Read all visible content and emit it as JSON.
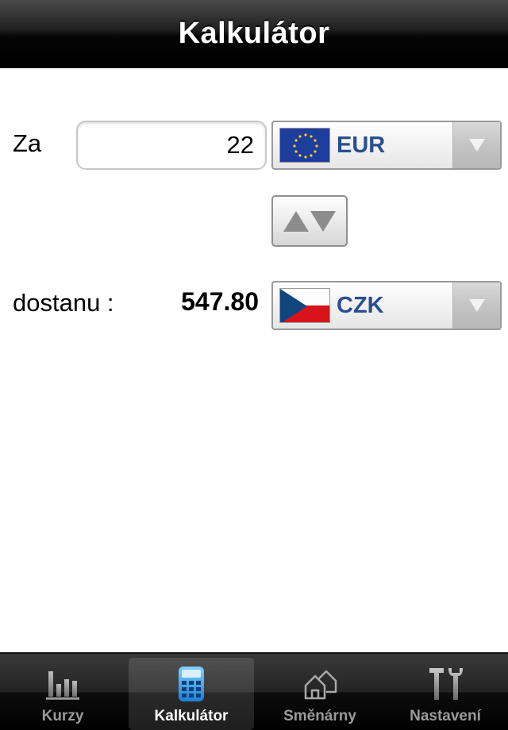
{
  "navbar": {
    "title": "Kalkulátor"
  },
  "converter": {
    "from_label": "Za",
    "amount": "22",
    "from_currency": {
      "code": "EUR",
      "flag": "eu-flag-icon"
    },
    "to_label": "dostanu :",
    "result": "547.80",
    "to_currency": {
      "code": "CZK",
      "flag": "cz-flag-icon"
    }
  },
  "tabs": [
    {
      "label": "Kurzy",
      "icon": "bar-chart-icon",
      "active": false
    },
    {
      "label": "Kalkulátor",
      "icon": "calculator-icon",
      "active": true
    },
    {
      "label": "Směnárny",
      "icon": "houses-icon",
      "active": false
    },
    {
      "label": "Nastavení",
      "icon": "tools-icon",
      "active": false
    }
  ],
  "colors": {
    "accent_blue": "#2a4f8f",
    "active_icon": "#3aa0e8"
  }
}
